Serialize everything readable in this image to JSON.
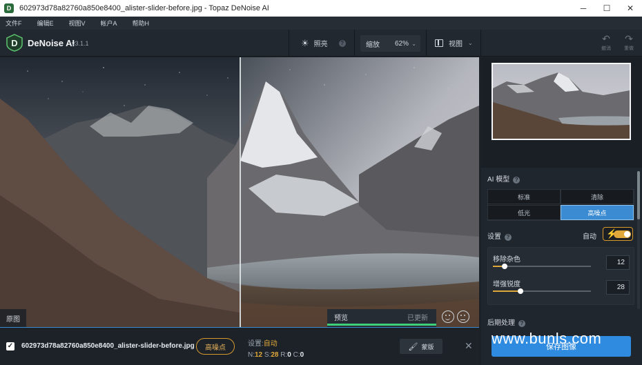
{
  "window": {
    "title": "602973d78a82760a850e8400_alister-slider-before.jpg - Topaz DeNoise AI",
    "minimize": "─",
    "maximize": "☐",
    "close": "✕"
  },
  "menu": [
    "文件F",
    "编辑E",
    "视图V",
    "帐户A",
    "帮助H"
  ],
  "toolbar": {
    "brand": "DeNoise AI",
    "version": "v3.1.1",
    "brightness_label": "照亮",
    "zoom_label": "缩放",
    "zoom_value": "62%",
    "view_label": "视图",
    "undo_label": "撤消",
    "redo_label": "重做"
  },
  "viewport": {
    "original_label": "原图",
    "preview_label": "预览",
    "preview_status": "已更新",
    "preview_progress": 1.0
  },
  "ai_model": {
    "title": "AI 模型",
    "options": [
      "标准",
      "清除",
      "低光",
      "高噪点"
    ],
    "selected": "高噪点"
  },
  "settings": {
    "title": "设置",
    "auto_label": "自动",
    "auto_enabled": true,
    "remove_noise_label": "移除杂色",
    "remove_noise_value": "12",
    "remove_noise_level": 0.12,
    "sharpen_label": "增强锐度",
    "sharpen_value": "28",
    "sharpen_level": 0.28
  },
  "post_processing": {
    "title": "后期处理"
  },
  "save_button": "保存图像",
  "file": {
    "name": "602973d78a82760a850e8400_alister-slider-before.jpg",
    "model_pill": "高噪点",
    "settings_prefix": "设置:",
    "settings_auto": "自动",
    "n_label": "N:",
    "n_value": "12",
    "s_label": "S:",
    "s_value": "28",
    "r_label": "R:",
    "r_value": "0",
    "c_label": "C:",
    "c_value": "0",
    "mask_label": "蒙版"
  },
  "watermark": "www.bunls.com",
  "colors": {
    "accent_blue": "#3a8bd1",
    "accent_orange": "#e0a83a",
    "preview_green": "#3fd17a",
    "save_blue": "#2f8be0"
  }
}
